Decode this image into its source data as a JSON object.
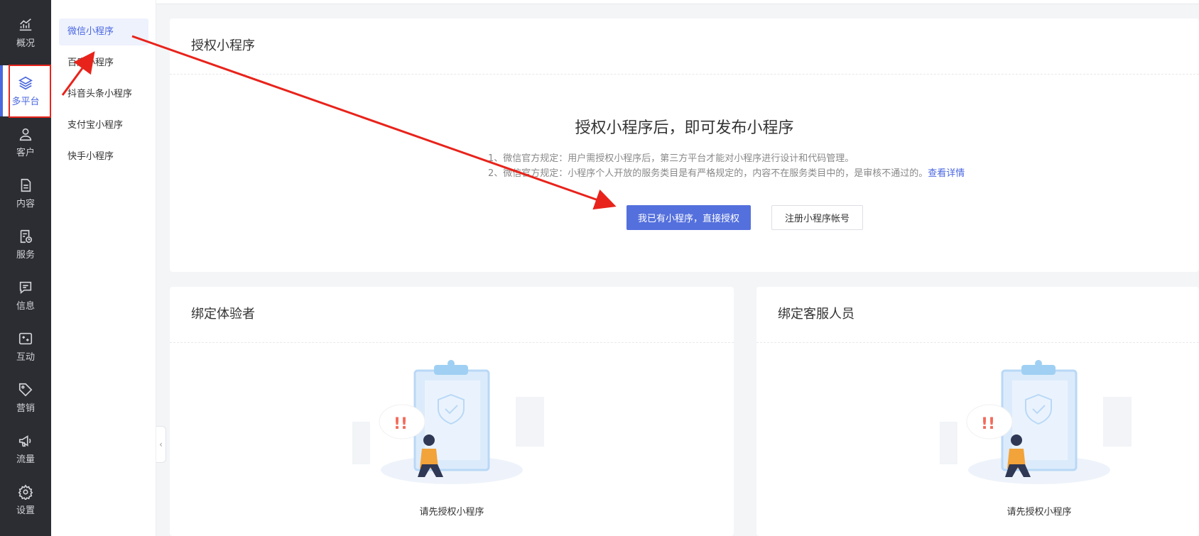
{
  "nav": {
    "items": [
      {
        "label": "概况",
        "icon": "chart-trend-icon"
      },
      {
        "label": "多平台",
        "icon": "layers-icon",
        "active": true
      },
      {
        "label": "客户",
        "icon": "user-icon"
      },
      {
        "label": "内容",
        "icon": "document-icon"
      },
      {
        "label": "服务",
        "icon": "service-icon"
      },
      {
        "label": "信息",
        "icon": "message-icon"
      },
      {
        "label": "互动",
        "icon": "interaction-icon"
      },
      {
        "label": "营销",
        "icon": "tag-icon"
      },
      {
        "label": "流量",
        "icon": "megaphone-icon"
      },
      {
        "label": "设置",
        "icon": "gear-icon"
      }
    ]
  },
  "submenu": {
    "items": [
      {
        "label": "微信小程序",
        "active": true
      },
      {
        "label": "百度小程序"
      },
      {
        "label": "抖音头条小程序"
      },
      {
        "label": "支付宝小程序"
      },
      {
        "label": "快手小程序"
      }
    ]
  },
  "auth": {
    "title": "授权小程序",
    "headline": "授权小程序后，即可发布小程序",
    "note1": "1、微信官方规定：用户需授权小程序后，第三方平台才能对小程序进行设计和代码管理。",
    "note2": "2、微信官方规定：小程序个人开放的服务类目是有严格规定的，内容不在服务类目中的，是审核不通过的。",
    "note2_link": "查看详情",
    "primary_button": "我已有小程序，直接授权",
    "secondary_button": "注册小程序帐号"
  },
  "testers": {
    "title": "绑定体验者",
    "empty_text": "请先授权小程序"
  },
  "service_staff": {
    "title": "绑定客服人员",
    "empty_text": "请先授权小程序"
  },
  "colors": {
    "accent": "#4a67e0",
    "primary_button": "#5470dd",
    "annotation": "#e8231b",
    "nav_bg": "#2b2d33"
  }
}
